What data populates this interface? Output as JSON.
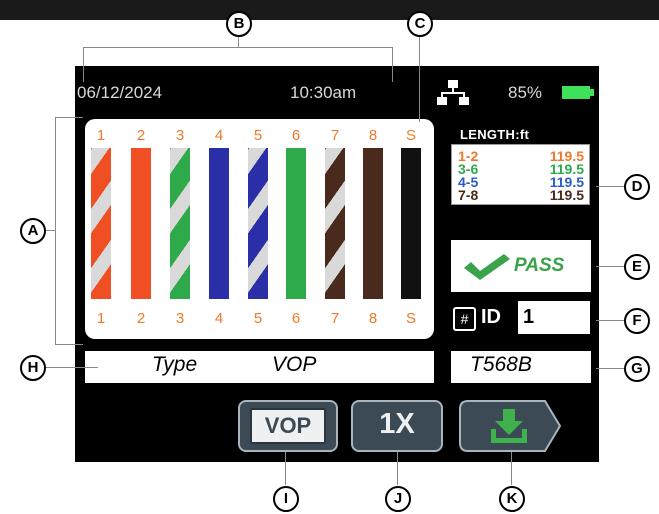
{
  "status": {
    "date": "06/12/2024",
    "time": "10:30am",
    "network_icon": "network-icon",
    "battery": "85%",
    "battery_level": 0.85
  },
  "pins": [
    "1",
    "2",
    "3",
    "4",
    "5",
    "6",
    "7",
    "8",
    "S"
  ],
  "wires": [
    {
      "pin": "1",
      "color": "#f04e23",
      "striped": true
    },
    {
      "pin": "2",
      "color": "#f04e23",
      "striped": false
    },
    {
      "pin": "3",
      "color": "#2eaa4a",
      "striped": true
    },
    {
      "pin": "4",
      "color": "#2a2fa8",
      "striped": false
    },
    {
      "pin": "5",
      "color": "#2a2fa8",
      "striped": true
    },
    {
      "pin": "6",
      "color": "#2eaa4a",
      "striped": false
    },
    {
      "pin": "7",
      "color": "#4a2a1c",
      "striped": true
    },
    {
      "pin": "8",
      "color": "#4a2a1c",
      "striped": false
    },
    {
      "pin": "S",
      "color": "#111111",
      "striped": false
    }
  ],
  "length": {
    "title": "LENGTH:ft",
    "rows": [
      {
        "pair": "1-2",
        "value": "119.5",
        "color": "#ee7a2a"
      },
      {
        "pair": "3-6",
        "value": "119.5",
        "color": "#2eaa4a"
      },
      {
        "pair": "4-5",
        "value": "119.5",
        "color": "#2a5cc8"
      },
      {
        "pair": "7-8",
        "value": "119.5",
        "color": "#4a2a1c"
      }
    ]
  },
  "result": {
    "label": "PASS",
    "icon": "check-icon",
    "color": "#3aa24a"
  },
  "id": {
    "hash": "#",
    "label": "ID",
    "value": "1"
  },
  "type_row": {
    "label": "Type",
    "value": "VOP"
  },
  "standard": "T568B",
  "buttons": {
    "vop": "VOP",
    "multiplier": "1X",
    "save_icon": "download-icon"
  },
  "callouts": [
    "A",
    "B",
    "C",
    "D",
    "E",
    "F",
    "G",
    "H",
    "I",
    "J",
    "K"
  ]
}
